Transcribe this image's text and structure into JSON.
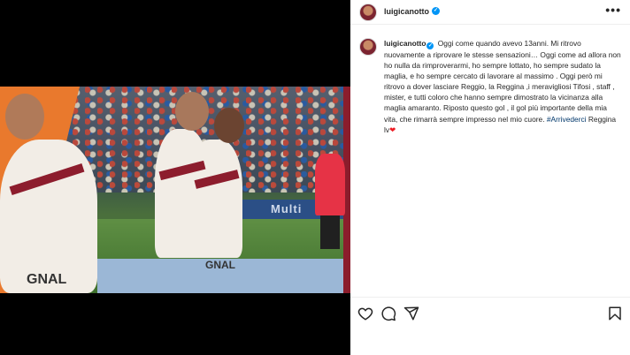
{
  "post": {
    "username": "luigicanotto",
    "more_label": "•••"
  },
  "media": {
    "banner_text": "Multi",
    "jersey_text_left": "GNAL",
    "jersey_text_right": "GNAL"
  },
  "caption": {
    "username": "luigicanotto",
    "text": "Oggi come quando avevo 13anni. Mi ritrovo nuovamente a riprovare le stesse sensazioni… Oggi come ad allora non ho nulla da rimproverarmi, ho sempre lottato, ho sempre sudato la maglia, e ho sempre cercato di lavorare al massimo . Oggi però mi ritrovo a dover lasciare Reggio, la Reggina ,i meravigliosi Tifosi , staff , mister, e tutti coloro che hanno sempre dimostrato la vicinanza alla maglia amaranto. Riposto questo gol , il gol più importante della mia vita, che rimarrà sempre impresso nel mio cuore.",
    "hashtag": "#Arrivederci",
    "tail": " Reggina lv",
    "heart": "❤"
  },
  "icons": {
    "like": "heart-icon",
    "comment": "comment-icon",
    "share": "share-icon",
    "save": "bookmark-icon"
  },
  "colors": {
    "verified": "#0095f6",
    "hashtag": "#00376b",
    "heart": "#ed1c24"
  }
}
